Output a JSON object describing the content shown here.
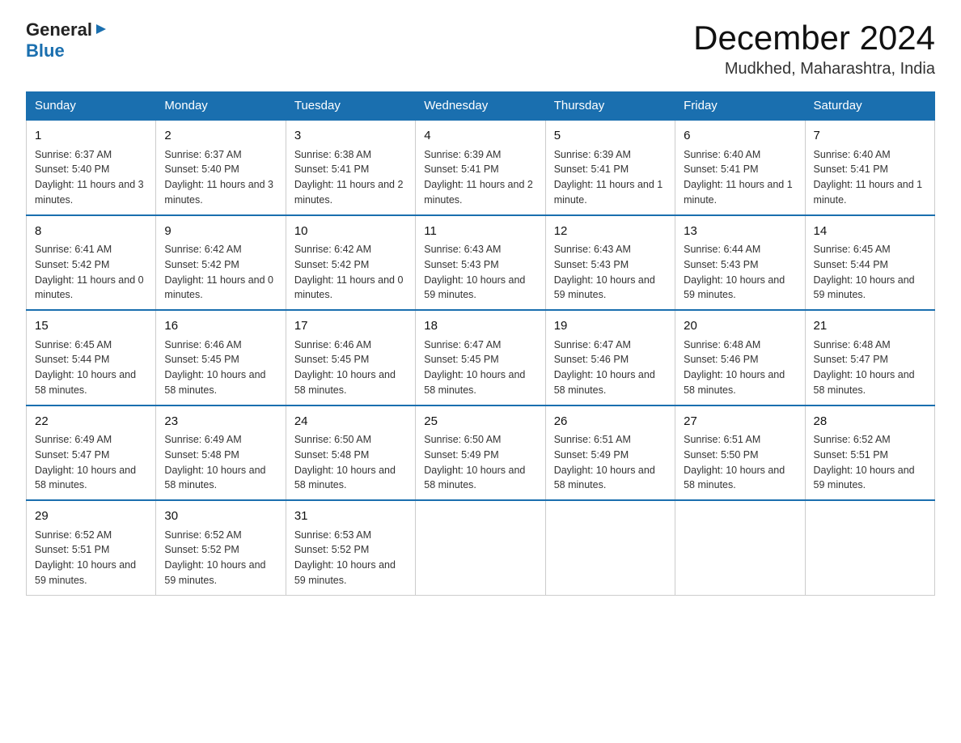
{
  "logo": {
    "general": "General",
    "blue": "Blue",
    "triangle": "▶"
  },
  "title": "December 2024",
  "subtitle": "Mudkhed, Maharashtra, India",
  "days_of_week": [
    "Sunday",
    "Monday",
    "Tuesday",
    "Wednesday",
    "Thursday",
    "Friday",
    "Saturday"
  ],
  "weeks": [
    [
      {
        "day": 1,
        "sunrise": "6:37 AM",
        "sunset": "5:40 PM",
        "daylight": "11 hours and 3 minutes."
      },
      {
        "day": 2,
        "sunrise": "6:37 AM",
        "sunset": "5:40 PM",
        "daylight": "11 hours and 3 minutes."
      },
      {
        "day": 3,
        "sunrise": "6:38 AM",
        "sunset": "5:41 PM",
        "daylight": "11 hours and 2 minutes."
      },
      {
        "day": 4,
        "sunrise": "6:39 AM",
        "sunset": "5:41 PM",
        "daylight": "11 hours and 2 minutes."
      },
      {
        "day": 5,
        "sunrise": "6:39 AM",
        "sunset": "5:41 PM",
        "daylight": "11 hours and 1 minute."
      },
      {
        "day": 6,
        "sunrise": "6:40 AM",
        "sunset": "5:41 PM",
        "daylight": "11 hours and 1 minute."
      },
      {
        "day": 7,
        "sunrise": "6:40 AM",
        "sunset": "5:41 PM",
        "daylight": "11 hours and 1 minute."
      }
    ],
    [
      {
        "day": 8,
        "sunrise": "6:41 AM",
        "sunset": "5:42 PM",
        "daylight": "11 hours and 0 minutes."
      },
      {
        "day": 9,
        "sunrise": "6:42 AM",
        "sunset": "5:42 PM",
        "daylight": "11 hours and 0 minutes."
      },
      {
        "day": 10,
        "sunrise": "6:42 AM",
        "sunset": "5:42 PM",
        "daylight": "11 hours and 0 minutes."
      },
      {
        "day": 11,
        "sunrise": "6:43 AM",
        "sunset": "5:43 PM",
        "daylight": "10 hours and 59 minutes."
      },
      {
        "day": 12,
        "sunrise": "6:43 AM",
        "sunset": "5:43 PM",
        "daylight": "10 hours and 59 minutes."
      },
      {
        "day": 13,
        "sunrise": "6:44 AM",
        "sunset": "5:43 PM",
        "daylight": "10 hours and 59 minutes."
      },
      {
        "day": 14,
        "sunrise": "6:45 AM",
        "sunset": "5:44 PM",
        "daylight": "10 hours and 59 minutes."
      }
    ],
    [
      {
        "day": 15,
        "sunrise": "6:45 AM",
        "sunset": "5:44 PM",
        "daylight": "10 hours and 58 minutes."
      },
      {
        "day": 16,
        "sunrise": "6:46 AM",
        "sunset": "5:45 PM",
        "daylight": "10 hours and 58 minutes."
      },
      {
        "day": 17,
        "sunrise": "6:46 AM",
        "sunset": "5:45 PM",
        "daylight": "10 hours and 58 minutes."
      },
      {
        "day": 18,
        "sunrise": "6:47 AM",
        "sunset": "5:45 PM",
        "daylight": "10 hours and 58 minutes."
      },
      {
        "day": 19,
        "sunrise": "6:47 AM",
        "sunset": "5:46 PM",
        "daylight": "10 hours and 58 minutes."
      },
      {
        "day": 20,
        "sunrise": "6:48 AM",
        "sunset": "5:46 PM",
        "daylight": "10 hours and 58 minutes."
      },
      {
        "day": 21,
        "sunrise": "6:48 AM",
        "sunset": "5:47 PM",
        "daylight": "10 hours and 58 minutes."
      }
    ],
    [
      {
        "day": 22,
        "sunrise": "6:49 AM",
        "sunset": "5:47 PM",
        "daylight": "10 hours and 58 minutes."
      },
      {
        "day": 23,
        "sunrise": "6:49 AM",
        "sunset": "5:48 PM",
        "daylight": "10 hours and 58 minutes."
      },
      {
        "day": 24,
        "sunrise": "6:50 AM",
        "sunset": "5:48 PM",
        "daylight": "10 hours and 58 minutes."
      },
      {
        "day": 25,
        "sunrise": "6:50 AM",
        "sunset": "5:49 PM",
        "daylight": "10 hours and 58 minutes."
      },
      {
        "day": 26,
        "sunrise": "6:51 AM",
        "sunset": "5:49 PM",
        "daylight": "10 hours and 58 minutes."
      },
      {
        "day": 27,
        "sunrise": "6:51 AM",
        "sunset": "5:50 PM",
        "daylight": "10 hours and 58 minutes."
      },
      {
        "day": 28,
        "sunrise": "6:52 AM",
        "sunset": "5:51 PM",
        "daylight": "10 hours and 59 minutes."
      }
    ],
    [
      {
        "day": 29,
        "sunrise": "6:52 AM",
        "sunset": "5:51 PM",
        "daylight": "10 hours and 59 minutes."
      },
      {
        "day": 30,
        "sunrise": "6:52 AM",
        "sunset": "5:52 PM",
        "daylight": "10 hours and 59 minutes."
      },
      {
        "day": 31,
        "sunrise": "6:53 AM",
        "sunset": "5:52 PM",
        "daylight": "10 hours and 59 minutes."
      },
      null,
      null,
      null,
      null
    ]
  ]
}
